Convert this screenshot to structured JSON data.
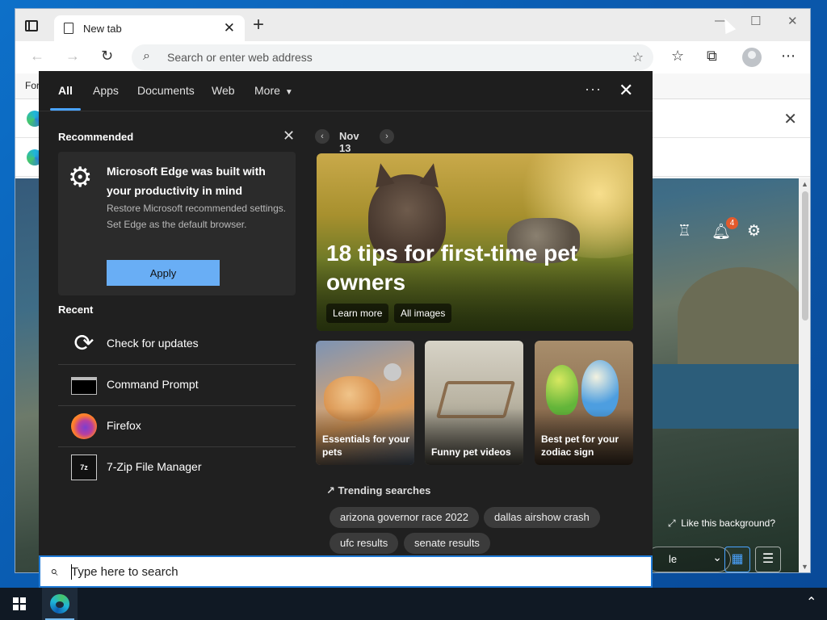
{
  "browser": {
    "tab_title": "New tab",
    "tab_close": "✕",
    "new_tab": "+",
    "address_placeholder": "Search or enter web address",
    "favorites_bar_text": "For"
  },
  "ntp": {
    "notification_count": "4",
    "like_background": "Like this background?",
    "layout_label": "le"
  },
  "panel": {
    "tabs": [
      {
        "label": "All",
        "active": true
      },
      {
        "label": "Apps"
      },
      {
        "label": "Documents"
      },
      {
        "label": "Web"
      },
      {
        "label": "More"
      }
    ],
    "more_caret": "▼",
    "dots": "···",
    "close": "✕",
    "recommended": {
      "title": "Recommended",
      "card_title": "Microsoft Edge was built with your productivity in mind",
      "card_body": "Restore Microsoft recommended settings. Set Edge as the default browser.",
      "apply_label": "Apply"
    },
    "recent": {
      "title": "Recent",
      "items": [
        {
          "label": "Check for updates",
          "icon": "refresh-icon"
        },
        {
          "label": "Command Prompt",
          "icon": "command-prompt-icon"
        },
        {
          "label": "Firefox",
          "icon": "firefox-icon"
        },
        {
          "label": "7-Zip File Manager",
          "icon": "7zip-icon",
          "glyph": "7z"
        }
      ]
    },
    "date": "Nov 13",
    "hero": {
      "title": "18 tips for first-time pet owners",
      "buttons": [
        "Learn more",
        "All images"
      ]
    },
    "thumbs": [
      "Essentials for your pets",
      "Funny pet videos",
      "Best pet for your zodiac sign"
    ],
    "trending": {
      "title": "Trending searches",
      "chips": [
        "arizona governor race 2022",
        "dallas airshow crash",
        "ufc results",
        "senate results"
      ]
    }
  },
  "search": {
    "placeholder": "Type here to search"
  },
  "colors": {
    "accent": "#4aa3ff",
    "apply_button": "#69aef5",
    "panel_bg": "#202020",
    "taskbar_bg": "#101924"
  }
}
